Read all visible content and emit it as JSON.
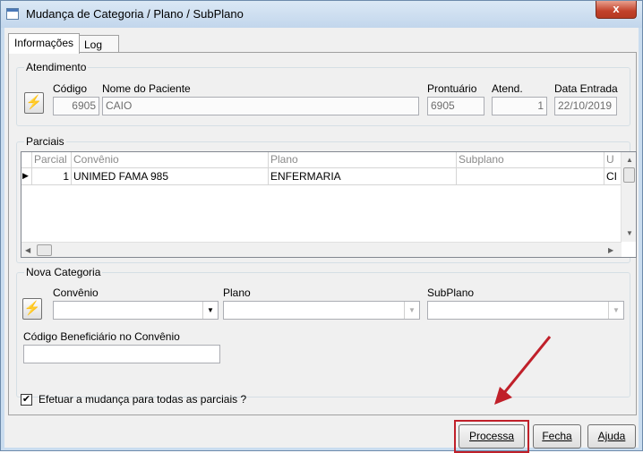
{
  "window": {
    "title": "Mudança de Categoria / Plano / SubPlano",
    "close_glyph": "x"
  },
  "tabs": [
    {
      "label": "Informações"
    },
    {
      "label": "Log"
    }
  ],
  "atendimento": {
    "group_label": "Atendimento",
    "codigo_label": "Código",
    "codigo_value": "6905",
    "nome_label": "Nome do Paciente",
    "nome_value": "CAIO",
    "prontuario_label": "Prontuário",
    "prontuario_value": "6905",
    "atend_label": "Atend.",
    "atend_value": "1",
    "data_label": "Data Entrada",
    "data_value": "22/10/2019"
  },
  "parciais": {
    "group_label": "Parciais",
    "columns": [
      "Parcial",
      "Convênio",
      "Plano",
      "Subplano",
      "U"
    ],
    "rows": [
      {
        "parcial": "1",
        "convenio": "UNIMED FAMA 985",
        "plano": "ENFERMARIA",
        "subplano": "",
        "u": "CI"
      }
    ]
  },
  "nova_categoria": {
    "group_label": "Nova Categoria",
    "convenio_label": "Convênio",
    "convenio_value": "",
    "plano_label": "Plano",
    "plano_value": "",
    "subplano_label": "SubPlano",
    "subplano_value": "",
    "beneficiario_label": "Código Beneficiário no Convênio",
    "beneficiario_value": ""
  },
  "options": {
    "apply_all_label": "Efetuar a mudança para todas as parciais ?",
    "apply_all_checked": true
  },
  "buttons": {
    "processa": "Processa",
    "fecha": "Fecha",
    "ajuda": "Ajuda"
  },
  "colors": {
    "highlight": "#c0202a",
    "title_bar": "#c9dcef"
  }
}
